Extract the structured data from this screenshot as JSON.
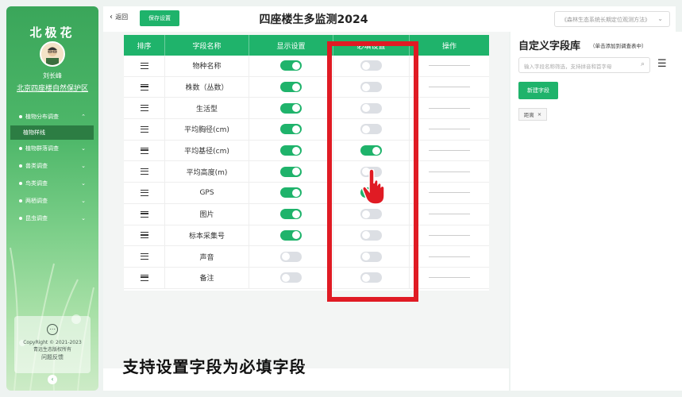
{
  "sidebar": {
    "logo": "北极花",
    "user_name": "刘长峰",
    "organization": "北京四座楼自然保护区",
    "menu": [
      {
        "label": "植物分布调查",
        "chev": "^"
      },
      {
        "label": "植物样线",
        "selected": true
      },
      {
        "label": "植物群落调查",
        "chev": "v"
      },
      {
        "label": "兽类调查",
        "chev": "v"
      },
      {
        "label": "鸟类调查",
        "chev": "v"
      },
      {
        "label": "两栖调查",
        "chev": "v"
      },
      {
        "label": "昆虫调查",
        "chev": "v"
      }
    ],
    "footer": {
      "copyright": "CopyRight © 2021-2023",
      "rights": "青远生态版权所有",
      "feedback": "问题反馈"
    }
  },
  "topbar": {
    "back_label": "返回",
    "save_label": "保存设置",
    "title": "四座楼生多监测2024",
    "method_select": "《森林生态系统长期定位观测方法》"
  },
  "table": {
    "headers": [
      "排序",
      "字段名称",
      "显示设置",
      "必填设置",
      "操作"
    ],
    "rows": [
      {
        "name": "物种名称",
        "display": true,
        "required": false
      },
      {
        "name": "株数（丛数）",
        "display": true,
        "required": false
      },
      {
        "name": "生活型",
        "display": true,
        "required": false
      },
      {
        "name": "平均胸径(cm)",
        "display": true,
        "required": false
      },
      {
        "name": "平均基径(cm)",
        "display": true,
        "required": true
      },
      {
        "name": "平均高度(m)",
        "display": true,
        "required": false
      },
      {
        "name": "GPS",
        "display": true,
        "required": true
      },
      {
        "name": "图片",
        "display": true,
        "required": false
      },
      {
        "name": "标本采集号",
        "display": true,
        "required": false
      },
      {
        "name": "声音",
        "display": false,
        "required": false
      },
      {
        "name": "备注",
        "display": false,
        "required": false
      }
    ]
  },
  "caption": "支持设置字段为必填字段",
  "panel": {
    "title": "自定义字段库",
    "hint": "（单击添加到调查表中）",
    "search_placeholder": "输入字段名称筛选，支持拼音和首字母",
    "new_field_label": "新建字段",
    "tags": [
      "距离"
    ]
  },
  "colors": {
    "accent": "#1fb36b",
    "highlight": "#e01b24",
    "sidebar": "#3aa65a"
  }
}
